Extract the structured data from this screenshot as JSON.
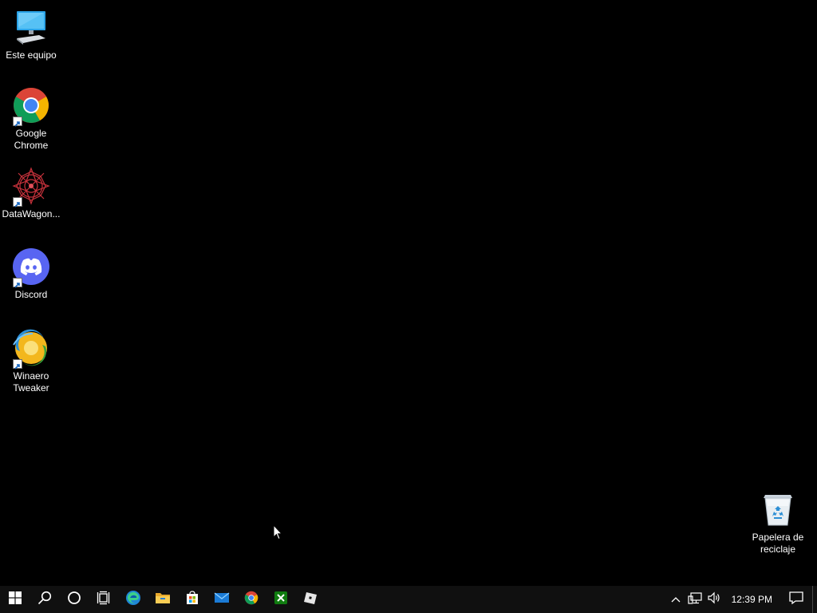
{
  "desktop": {
    "icons": [
      {
        "name": "this-pc",
        "label": "Este equipo"
      },
      {
        "name": "google-chrome",
        "label": "Google Chrome"
      },
      {
        "name": "datawagon",
        "label": "DataWagon..."
      },
      {
        "name": "discord",
        "label": "Discord"
      },
      {
        "name": "winaero-tweaker",
        "label": "Winaero Tweaker"
      },
      {
        "name": "recycle-bin",
        "label": "Papelera de reciclaje"
      }
    ]
  },
  "taskbar": {
    "pinned": [
      "start-icon",
      "search-icon",
      "cortana-icon",
      "task-view-icon",
      "edge-icon",
      "file-explorer-icon",
      "store-icon",
      "mail-icon",
      "chrome-icon",
      "xbox-icon",
      "roblox-icon"
    ],
    "tray": {
      "clock": "12:39 PM"
    }
  },
  "colors": {
    "background": "#000000",
    "taskbar": "#101010",
    "discord": "#5865F2",
    "chrome_red": "#DB4437",
    "chrome_yellow": "#F4B400",
    "chrome_green": "#0F9D58",
    "chrome_blue": "#4285F4",
    "xbox_green": "#107C10"
  }
}
